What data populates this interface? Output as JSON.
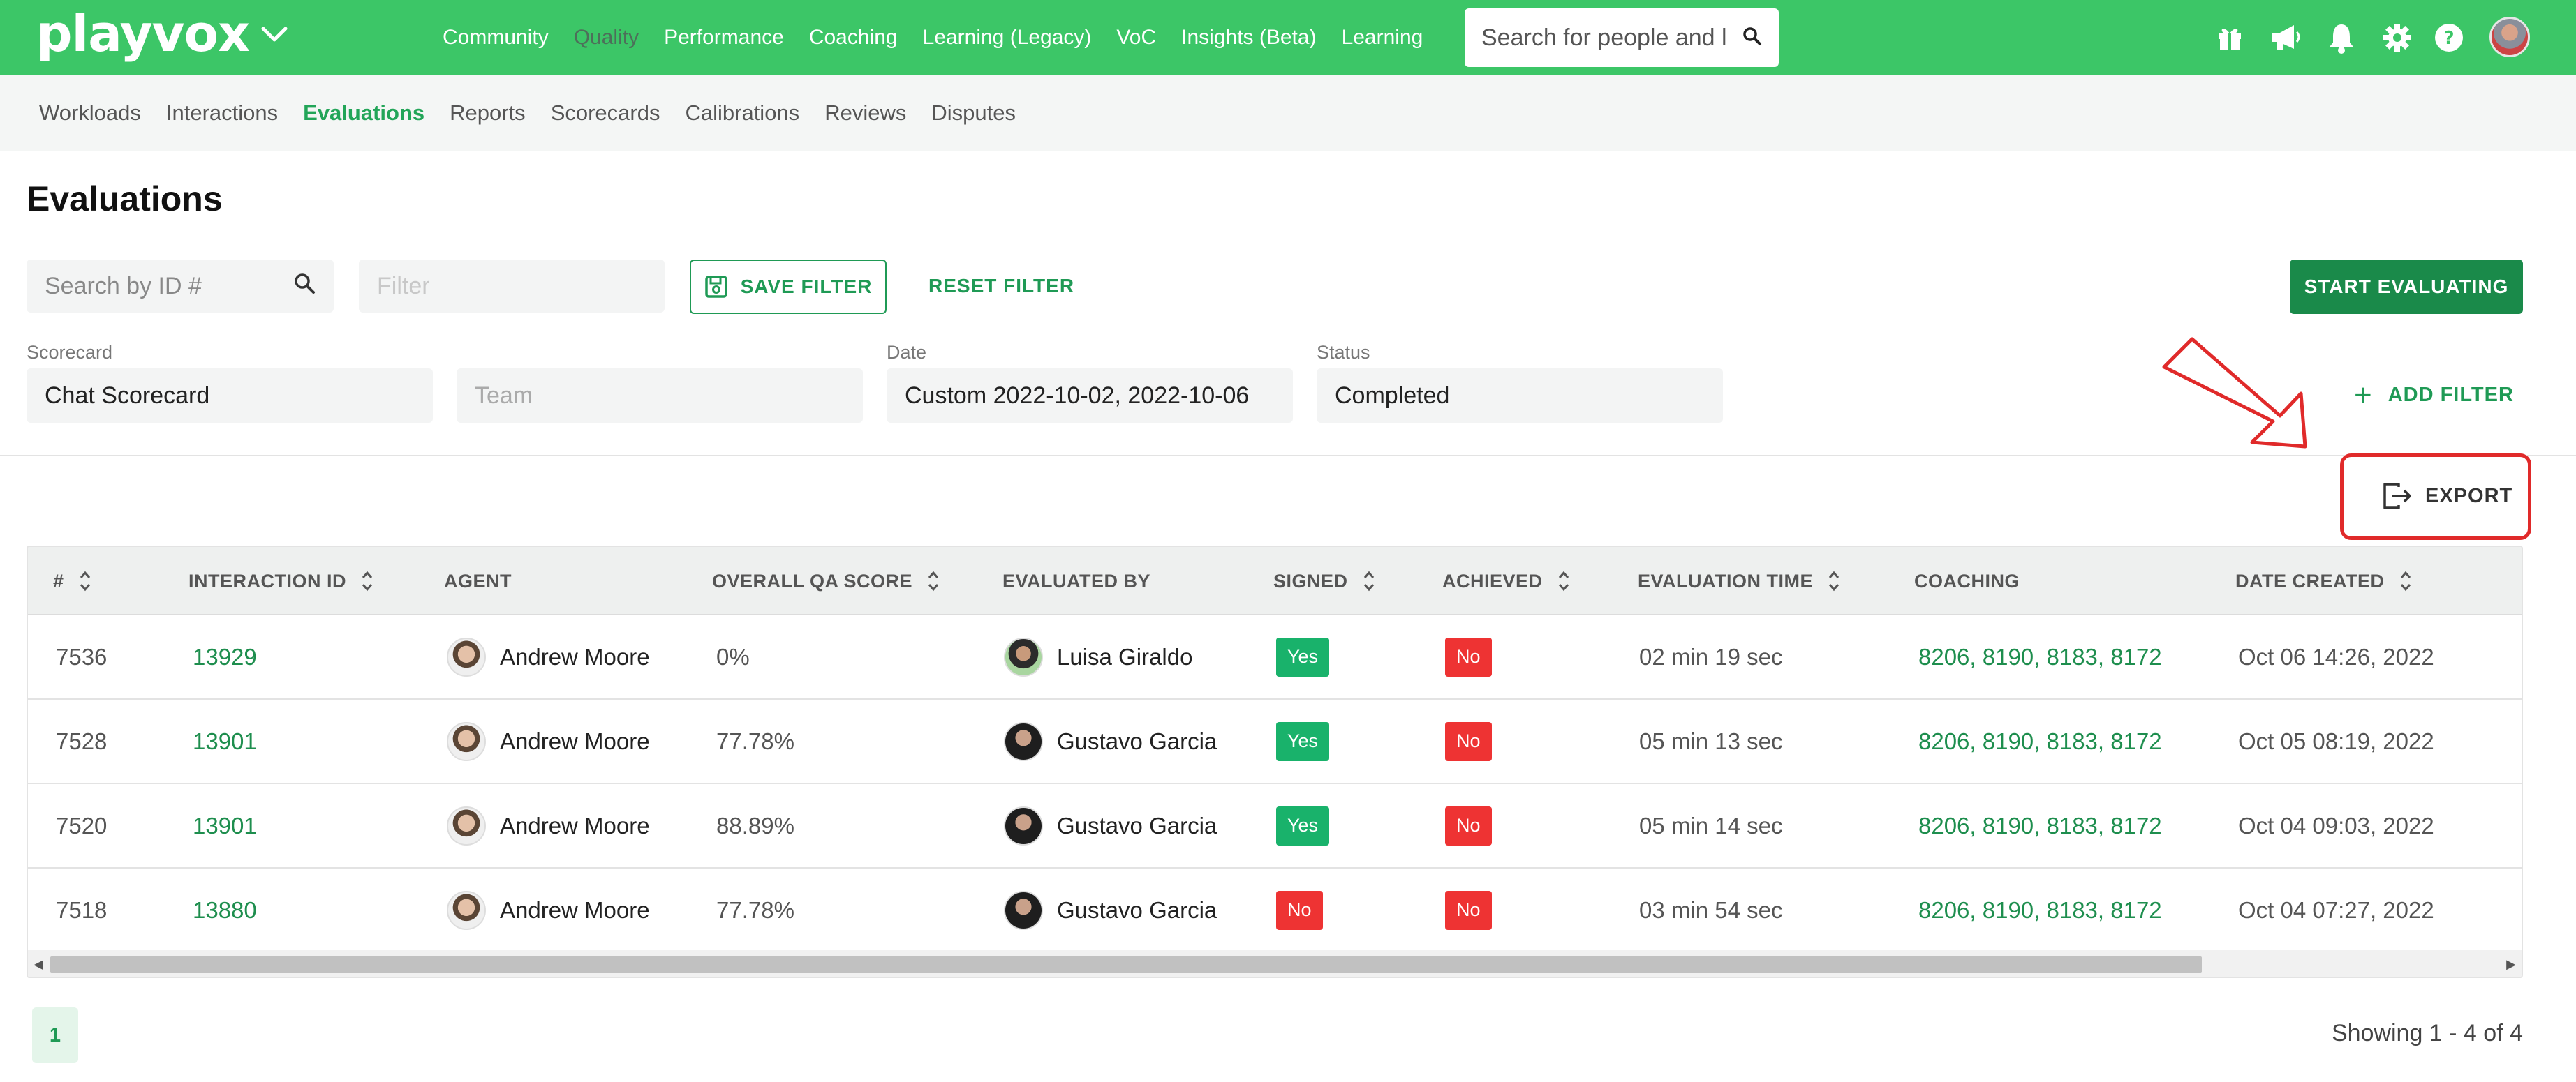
{
  "brand": {
    "logo": "playvox"
  },
  "main_nav": [
    "Community",
    "Quality",
    "Performance",
    "Coaching",
    "Learning (Legacy)",
    "VoC",
    "Insights (Beta)",
    "Learning"
  ],
  "main_nav_active": "Quality",
  "search": {
    "placeholder": "Search for people and l"
  },
  "top_icons": [
    "gift-icon",
    "megaphone-icon",
    "bell-icon",
    "gear-icon",
    "help-icon",
    "user-avatar"
  ],
  "sub_nav": [
    "Workloads",
    "Interactions",
    "Evaluations",
    "Reports",
    "Scorecards",
    "Calibrations",
    "Reviews",
    "Disputes"
  ],
  "sub_nav_active": "Evaluations",
  "page": {
    "title": "Evaluations"
  },
  "toolbar": {
    "id_search_placeholder": "Search by ID #",
    "filter_placeholder": "Filter",
    "save_filter": "SAVE FILTER",
    "reset_filter": "RESET FILTER",
    "start_evaluating": "START EVALUATING"
  },
  "filters": {
    "scorecard": {
      "label": "Scorecard",
      "value": "Chat Scorecard"
    },
    "team": {
      "placeholder": "Team"
    },
    "date": {
      "label": "Date",
      "value": "Custom 2022-10-02, 2022-10-06"
    },
    "status": {
      "label": "Status",
      "value": "Completed"
    },
    "add_filter": "ADD FILTER"
  },
  "export": {
    "label": "EXPORT"
  },
  "table": {
    "columns": [
      "#",
      "INTERACTION ID",
      "AGENT",
      "OVERALL QA SCORE",
      "EVALUATED BY",
      "SIGNED",
      "ACHIEVED",
      "EVALUATION TIME",
      "COACHING",
      "DATE CREATED"
    ],
    "rows": [
      {
        "num": "7536",
        "interaction_id": "13929",
        "agent": "Andrew Moore",
        "score": "0%",
        "evaluated_by": "Luisa Giraldo",
        "signed": "Yes",
        "achieved": "No",
        "time": "02 min 19 sec",
        "coaching": "8206, 8190, 8183, 8172",
        "date": "Oct 06 14:26, 2022"
      },
      {
        "num": "7528",
        "interaction_id": "13901",
        "agent": "Andrew Moore",
        "score": "77.78%",
        "evaluated_by": "Gustavo Garcia",
        "signed": "Yes",
        "achieved": "No",
        "time": "05 min 13 sec",
        "coaching": "8206, 8190, 8183, 8172",
        "date": "Oct 05 08:19, 2022"
      },
      {
        "num": "7520",
        "interaction_id": "13901",
        "agent": "Andrew Moore",
        "score": "88.89%",
        "evaluated_by": "Gustavo Garcia",
        "signed": "Yes",
        "achieved": "No",
        "time": "05 min 14 sec",
        "coaching": "8206, 8190, 8183, 8172",
        "date": "Oct 04 09:03, 2022"
      },
      {
        "num": "7518",
        "interaction_id": "13880",
        "agent": "Andrew Moore",
        "score": "77.78%",
        "evaluated_by": "Gustavo Garcia",
        "signed": "No",
        "achieved": "No",
        "time": "03 min 54 sec",
        "coaching": "8206, 8190, 8183, 8172",
        "date": "Oct 04 07:27, 2022"
      }
    ]
  },
  "pagination": {
    "current_page": "1",
    "showing": "Showing 1 - 4 of 4"
  },
  "colors": {
    "brand_green": "#3cc667",
    "accent_green": "#1f9a55",
    "yes": "#19b26b",
    "no": "#ee3333",
    "annotation_red": "#e02a2a"
  }
}
